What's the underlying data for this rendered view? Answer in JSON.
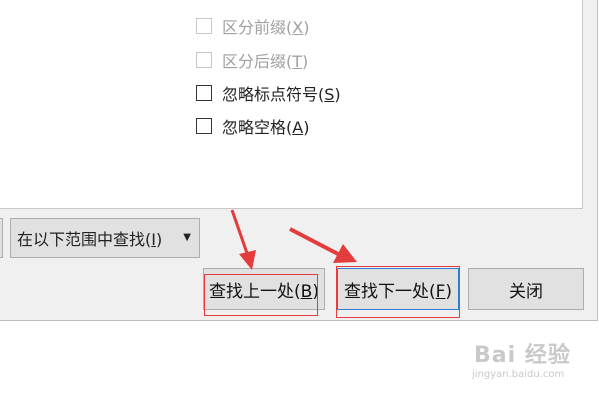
{
  "options": [
    {
      "label": "区分前缀(",
      "key": "X",
      "suffix": ")",
      "checked": false,
      "disabled": true
    },
    {
      "label": "区分后缀(",
      "key": "T",
      "suffix": ")",
      "checked": false,
      "disabled": true
    },
    {
      "label": "忽略标点符号(",
      "key": "S",
      "suffix": ")",
      "checked": false,
      "disabled": false
    },
    {
      "label": "忽略空格(",
      "key": "A",
      "suffix": ")",
      "checked": false,
      "disabled": false
    }
  ],
  "scope_dropdown": {
    "label": "在以下范围中查找(",
    "key": "I",
    "suffix": ")",
    "caret": "▼"
  },
  "buttons": {
    "find_prev": {
      "label": "查找上一处(",
      "key": "B",
      "suffix": ")"
    },
    "find_next": {
      "label": "查找下一处(",
      "key": "F",
      "suffix": ")"
    },
    "close": {
      "label": "关闭"
    }
  },
  "watermark": {
    "text": "Bai 经验",
    "sub": "jingyan.baidu.com"
  },
  "colors": {
    "annotation": "#e23c3c",
    "focus_border": "#2f7fd4",
    "dialog_bg": "#f0f0f0"
  }
}
